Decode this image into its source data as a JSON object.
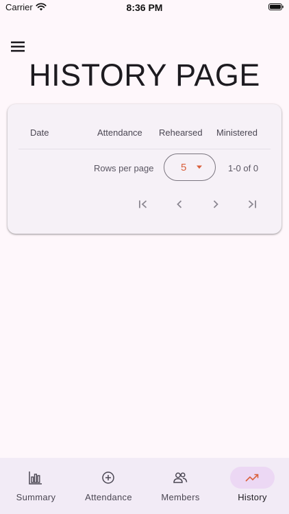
{
  "status_bar": {
    "carrier": "Carrier",
    "time": "8:36 PM"
  },
  "header": {
    "title": "HISTORY PAGE"
  },
  "table": {
    "columns": [
      "Date",
      "Attendance",
      "Rehearsed",
      "Ministered"
    ],
    "footer": {
      "rows_per_page_label": "Rows per page",
      "rows_per_page_value": "5",
      "range": "1-0 of 0"
    }
  },
  "bottom_nav": {
    "items": [
      {
        "label": "Summary",
        "icon": "bar-chart-icon"
      },
      {
        "label": "Attendance",
        "icon": "add-circle-icon"
      },
      {
        "label": "Members",
        "icon": "people-icon"
      },
      {
        "label": "History",
        "icon": "trending-up-icon",
        "active": true
      }
    ]
  },
  "colors": {
    "accent": "#d9603c",
    "nav_active_bg": "#ecd8f4",
    "background": "#fef7fb"
  }
}
